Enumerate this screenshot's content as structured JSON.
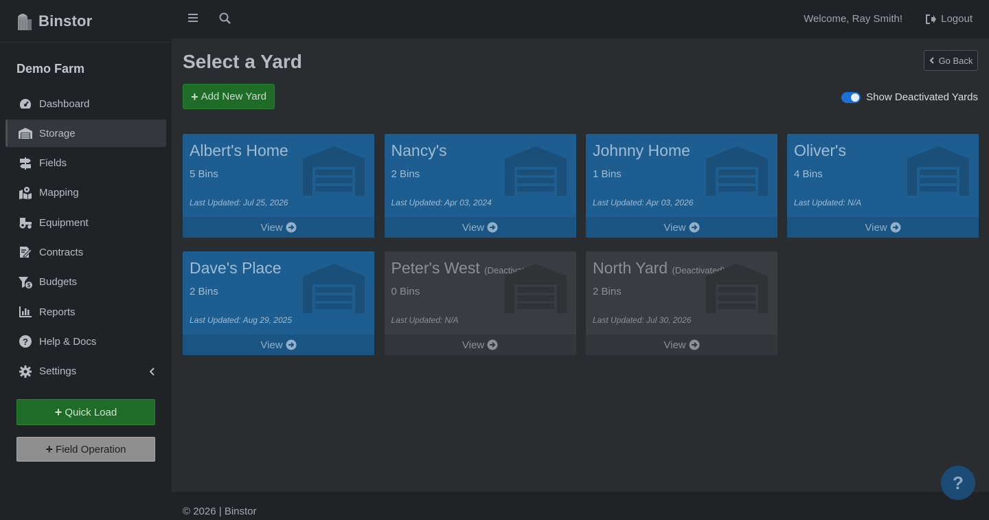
{
  "brand": {
    "name": "Binstor"
  },
  "farm": {
    "name": "Demo Farm"
  },
  "sidebar": {
    "items": [
      {
        "label": "Dashboard",
        "icon": "tachometer-icon"
      },
      {
        "label": "Storage",
        "icon": "warehouse-icon",
        "active": true
      },
      {
        "label": "Fields",
        "icon": "signpost-icon"
      },
      {
        "label": "Mapping",
        "icon": "map-marker-icon"
      },
      {
        "label": "Equipment",
        "icon": "tractor-icon"
      },
      {
        "label": "Contracts",
        "icon": "contract-icon"
      },
      {
        "label": "Budgets",
        "icon": "budget-icon"
      },
      {
        "label": "Reports",
        "icon": "bar-chart-icon"
      },
      {
        "label": "Help & Docs",
        "icon": "question-circle-icon"
      },
      {
        "label": "Settings",
        "icon": "gear-icon"
      }
    ],
    "quick_load": "Quick Load",
    "field_operation": "Field Operation"
  },
  "topbar": {
    "welcome": "Welcome, Ray Smith!",
    "logout": "Logout"
  },
  "main": {
    "title": "Select a Yard",
    "go_back": "Go Back",
    "add_yard": "Add New Yard",
    "toggle_label": "Show Deactivated Yards",
    "toggle_on": true
  },
  "yards": [
    {
      "name": "Albert's Home",
      "bins": "5 Bins",
      "updated": "Last Updated: Jul 25, 2026",
      "view": "View",
      "deactivated": false,
      "deact_label": ""
    },
    {
      "name": "Nancy's",
      "bins": "2 Bins",
      "updated": "Last Updated: Apr 03, 2024",
      "view": "View",
      "deactivated": false,
      "deact_label": ""
    },
    {
      "name": "Johnny Home",
      "bins": "1 Bins",
      "updated": "Last Updated: Apr 03, 2026",
      "view": "View",
      "deactivated": false,
      "deact_label": ""
    },
    {
      "name": "Oliver's",
      "bins": "4 Bins",
      "updated": "Last Updated: N/A",
      "view": "View",
      "deactivated": false,
      "deact_label": ""
    },
    {
      "name": "Dave's Place",
      "bins": "2 Bins",
      "updated": "Last Updated: Aug 29, 2025",
      "view": "View",
      "deactivated": false,
      "deact_label": ""
    },
    {
      "name": "Peter's West",
      "bins": "0 Bins",
      "updated": "Last Updated: N/A",
      "view": "View",
      "deactivated": true,
      "deact_label": "(Deactivated)"
    },
    {
      "name": "North Yard",
      "bins": "2 Bins",
      "updated": "Last Updated: Jul 30, 2026",
      "view": "View",
      "deactivated": true,
      "deact_label": "(Deactivated)"
    }
  ],
  "footer": {
    "text": "© 2026 | Binstor"
  },
  "help_fab": "?",
  "colors": {
    "active_card": "#1d5d8f",
    "deactivated_card": "#393c40",
    "success": "#1f6b28",
    "toggle": "#1d6fd8"
  }
}
